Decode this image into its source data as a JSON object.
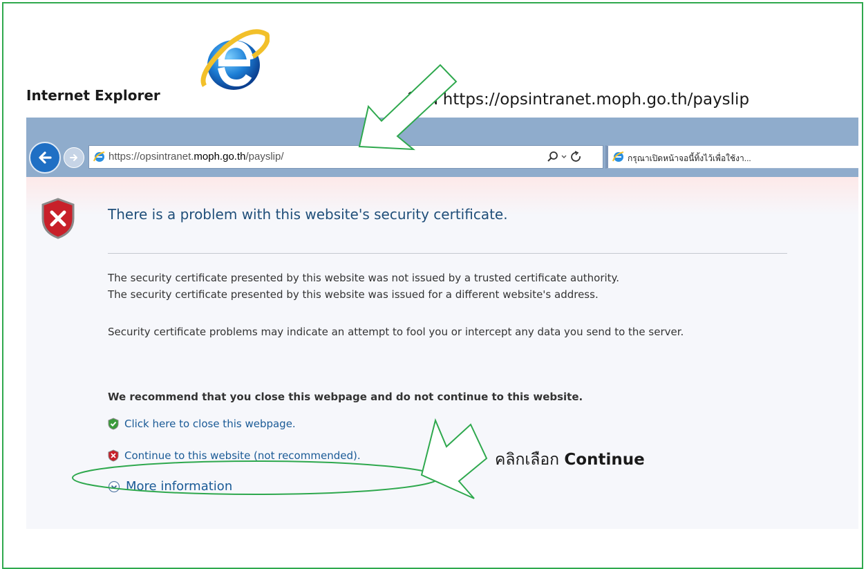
{
  "caption": {
    "app_name": "Internet Explorer"
  },
  "instructions": {
    "type_url": "พิมพ์ https://opsintranet.moph.go.th/payslip",
    "click_prefix": "คลิกเลือก ",
    "click_strong": "Continue"
  },
  "browser": {
    "address_prefix": "https://opsintranet.",
    "address_host": "moph.go.th",
    "address_suffix": "/payslip/",
    "tab_title": "กรุณาเปิดหน้าจอนี้ทิ้งไว้เพื่อใช้งา..."
  },
  "error_page": {
    "title": "There is a problem with this website's security certificate.",
    "line1": "The security certificate presented by this website was not issued by a trusted certificate authority.",
    "line2": "The security certificate presented by this website was issued for a different website's address.",
    "warning": "Security certificate problems may indicate an attempt to fool you or intercept any data you send to the server.",
    "recommend": "We recommend that you close this webpage and do not continue to this website.",
    "close_link": "Click here to close this webpage.",
    "continue_link": "Continue to this website (not recommended).",
    "more_info": "More information"
  },
  "colors": {
    "annotation_green": "#2ea84d",
    "link_blue": "#1a5a96",
    "title_blue": "#1f4e79",
    "chrome_blue": "#8faccc"
  }
}
